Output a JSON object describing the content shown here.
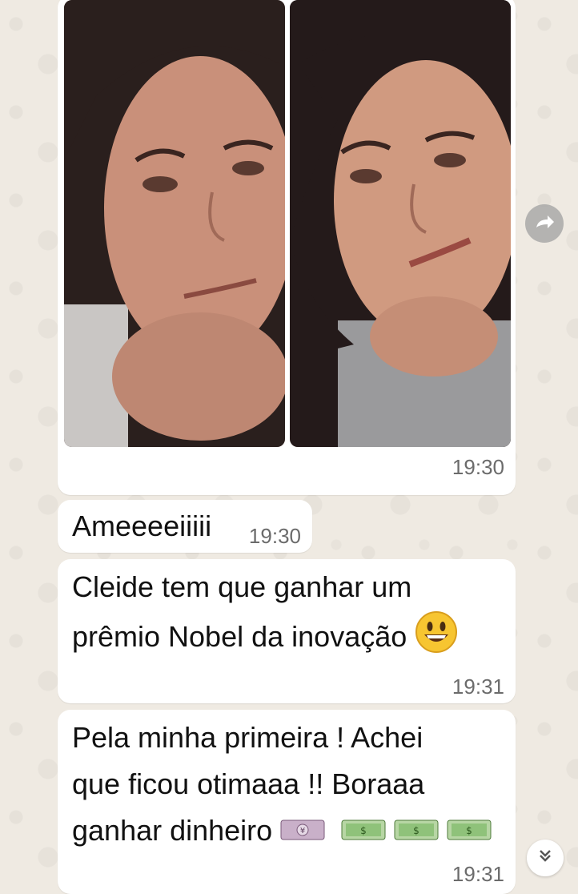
{
  "chat": {
    "media_message": {
      "time": "19:30"
    },
    "messages": [
      {
        "text_lines": [
          "Ameeeeiiiii"
        ],
        "time": "19:30"
      },
      {
        "text_lines": [
          "Cleide tem que ganhar um",
          "prêmio Nobel da inovação"
        ],
        "emoji": "grinning-face",
        "time": "19:31"
      },
      {
        "text_lines": [
          "Pela minha primeira ! Achei",
          "que ficou otimaaa !! Boraaa",
          "ganhar dinheiro"
        ],
        "emojis": [
          "yen-banknote",
          "dollar-banknote",
          "dollar-banknote",
          "dollar-banknote"
        ],
        "time": "19:31"
      }
    ]
  },
  "controls": {
    "forward_icon": "forward-icon",
    "scroll_down_icon": "double-chevron-down-icon"
  },
  "colors": {
    "wallpaper": "#efeae2",
    "bubble": "#ffffff",
    "timestamp": "#6b6b6b"
  }
}
